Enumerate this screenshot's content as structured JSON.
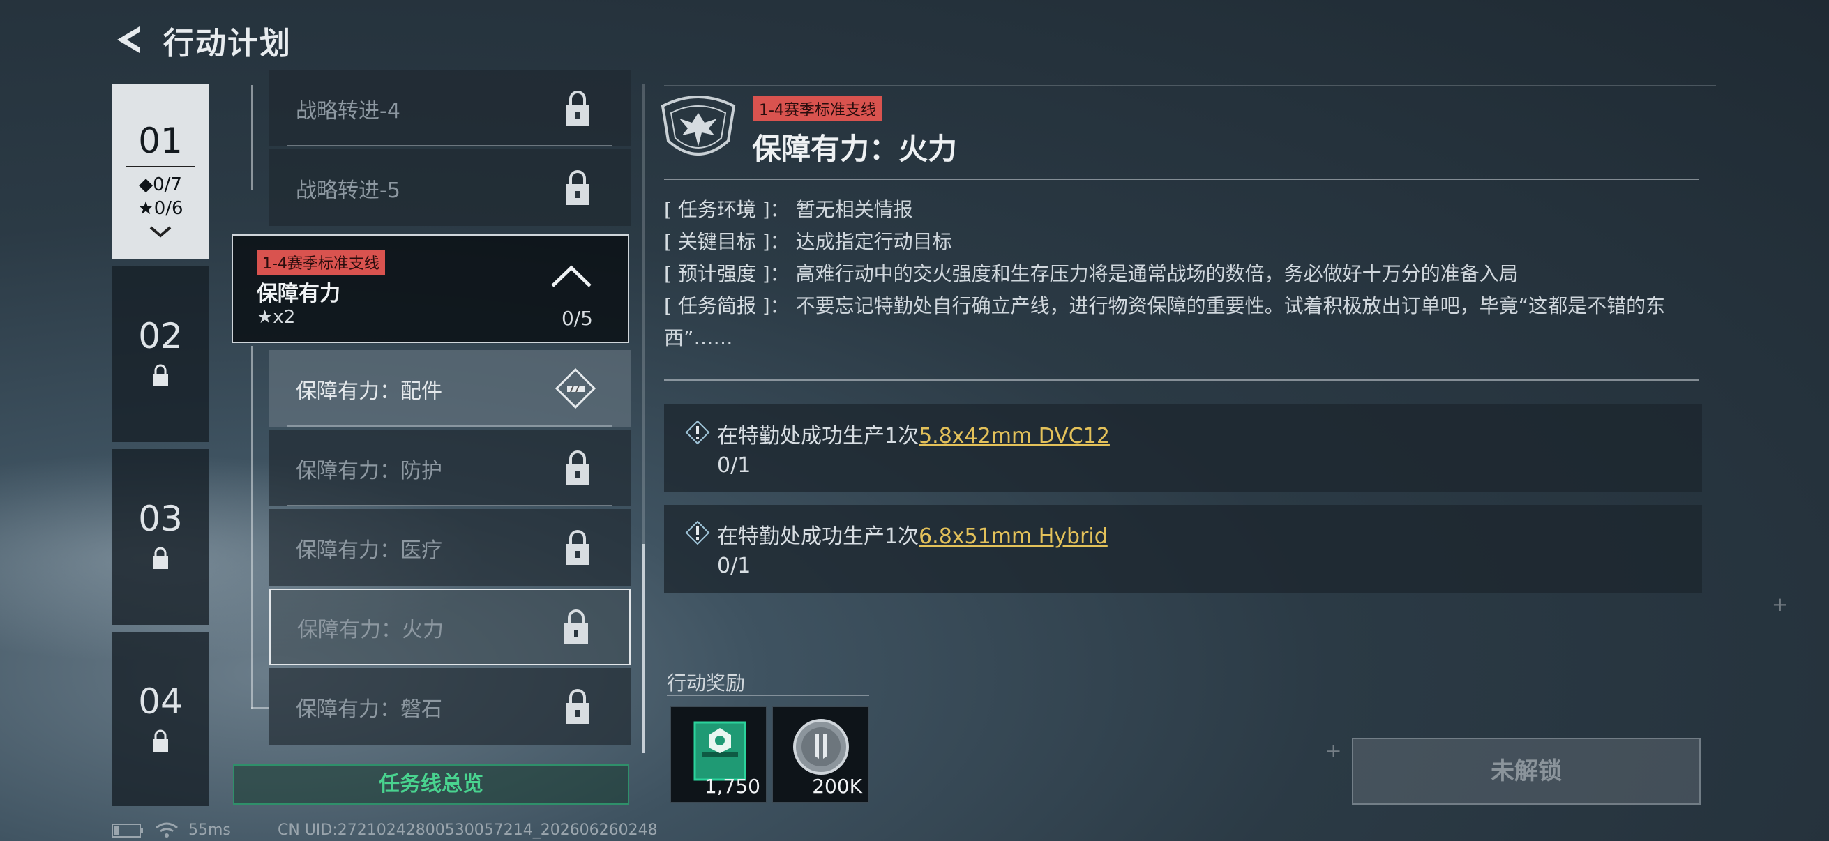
{
  "header": {
    "title": "行动计划"
  },
  "chapters": [
    {
      "num": "01",
      "diamond": "◆0/7",
      "star": "★0/6",
      "active": true
    },
    {
      "num": "02"
    },
    {
      "num": "03"
    },
    {
      "num": "04"
    }
  ],
  "missions_top": [
    {
      "label": "战略转进-4"
    },
    {
      "label": "战略转进-5"
    }
  ],
  "group": {
    "tag": "1-4赛季标准支线",
    "title": "保障有力",
    "stars": "★x2",
    "progress": "0/5"
  },
  "missions": [
    {
      "label": "保障有力：配件",
      "state": "current"
    },
    {
      "label": "保障有力：防护"
    },
    {
      "label": "保障有力：医疗"
    },
    {
      "label": "保障有力：火力",
      "state": "selected"
    },
    {
      "label": "保障有力：磐石"
    }
  ],
  "overview_label": "任务线总览",
  "detail": {
    "tag": "1-4赛季标准支线",
    "title": "保障有力：火力",
    "env_key": "[ 任务环境 ]",
    "env_val": "暂无相关情报",
    "goal_key": "[ 关键目标 ]",
    "goal_val": "达成指定行动目标",
    "intensity_key": "[ 预计强度 ]",
    "intensity_val": "高难行动中的交火强度和生存压力将是通常战场的数倍，务必做好十万分的准备入局",
    "brief_key": "[ 任务简报 ]",
    "brief_val": "不要忘记特勤处自行确立产线，进行物资保障的重要性。试着积极放出订单吧，毕竟“这都是不错的东西”……",
    "objectives": [
      {
        "prefix": "在特勤处成功生产1次",
        "item": "5.8x42mm DVC12",
        "count": "0/1"
      },
      {
        "prefix": "在特勤处成功生产1次",
        "item": "6.8x51mm Hybrid",
        "count": "0/1"
      }
    ]
  },
  "rewards": {
    "heading": "行动奖励",
    "items": [
      {
        "amount": "1,750",
        "icon": "green-card-icon"
      },
      {
        "amount": "200K",
        "icon": "silver-coin-icon"
      }
    ]
  },
  "unlock_label": "未解锁",
  "status": {
    "ping": "55ms",
    "uid": "CN UID:27210242800530057214_202606260248"
  },
  "colors": {
    "accent_green": "#49d38f",
    "tag_red": "#d9534f",
    "link_yellow": "#e3c15a"
  }
}
